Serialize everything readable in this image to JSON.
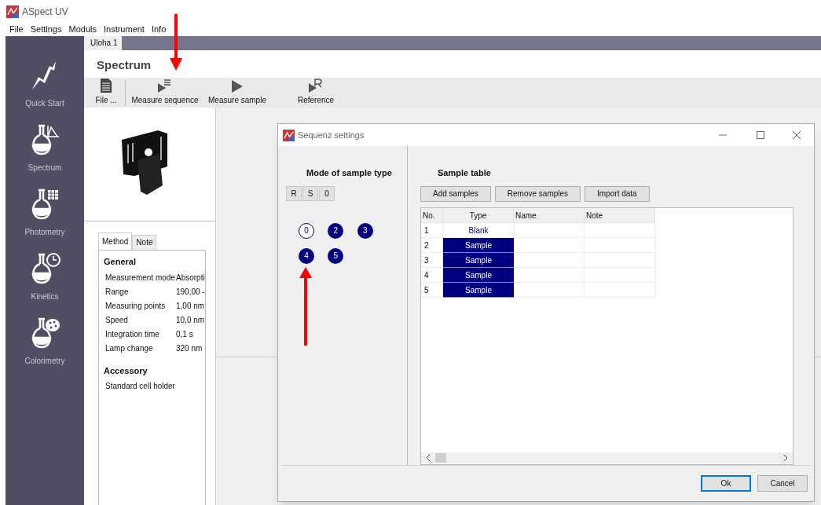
{
  "window": {
    "title": "ASpect UV"
  },
  "menu": [
    "File",
    "Settings",
    "Moduls",
    "Instrument",
    "Info"
  ],
  "sidebar": {
    "items": [
      {
        "kind": "quickstart",
        "label": "Quick Start"
      },
      {
        "kind": "spectrum",
        "label": "Spectrum"
      },
      {
        "kind": "photometry",
        "label": "Photometry"
      },
      {
        "kind": "kinetics",
        "label": "Kinetics"
      },
      {
        "kind": "colorimetry",
        "label": "Colorimetry"
      }
    ]
  },
  "document_tabs": [
    {
      "label": "Uloha 1",
      "selected": true
    }
  ],
  "heading": "Spectrum",
  "toolbar": [
    {
      "kind": "file",
      "label": "File ..."
    },
    {
      "kind": "sequence",
      "label": "Measure sequence"
    },
    {
      "kind": "play",
      "label": "Measure sample"
    },
    {
      "kind": "reference",
      "label": "Reference"
    }
  ],
  "method_tabs": [
    {
      "label": "Method",
      "selected": true
    },
    {
      "label": "Note",
      "selected": false
    }
  ],
  "method": {
    "general_title": "General",
    "rows": [
      {
        "label": "Measurement mode",
        "value": "Absorpti"
      },
      {
        "label": "Range",
        "value": "190,00 -"
      },
      {
        "label": "Measuring points",
        "value": "1,00 nm"
      },
      {
        "label": "Speed",
        "value": "10,0 nm"
      },
      {
        "label": "Integration time",
        "value": "0,1 s"
      },
      {
        "label": "Lamp change",
        "value": "320 nm"
      }
    ],
    "accessory_title": "Accessory",
    "accessory": "Standard cell holder"
  },
  "dialog": {
    "title": "Sequenz settings",
    "mode_title": "Mode of sample type",
    "mode_buttons": [
      "R",
      "S",
      "0"
    ],
    "positions": [
      {
        "label": "0",
        "kind": "blank"
      },
      {
        "label": "2",
        "kind": "sample"
      },
      {
        "label": "3",
        "kind": "sample"
      },
      {
        "label": "4",
        "kind": "sample"
      },
      {
        "label": "5",
        "kind": "sample"
      }
    ],
    "table_title": "Sample table",
    "table_buttons": [
      "Add samples",
      "Remove samples",
      "Import data"
    ],
    "columns": [
      "No.",
      "Type",
      "Name",
      "Note"
    ],
    "rows": [
      {
        "no": "1",
        "type": "Blank",
        "kind": "blank"
      },
      {
        "no": "2",
        "type": "Sample",
        "kind": "sample"
      },
      {
        "no": "3",
        "type": "Sample",
        "kind": "sample"
      },
      {
        "no": "4",
        "type": "Sample",
        "kind": "sample"
      },
      {
        "no": "5",
        "type": "Sample",
        "kind": "sample"
      }
    ],
    "buttons": [
      {
        "label": "Ok",
        "selected": true
      },
      {
        "label": "Cancel",
        "selected": false
      }
    ]
  }
}
